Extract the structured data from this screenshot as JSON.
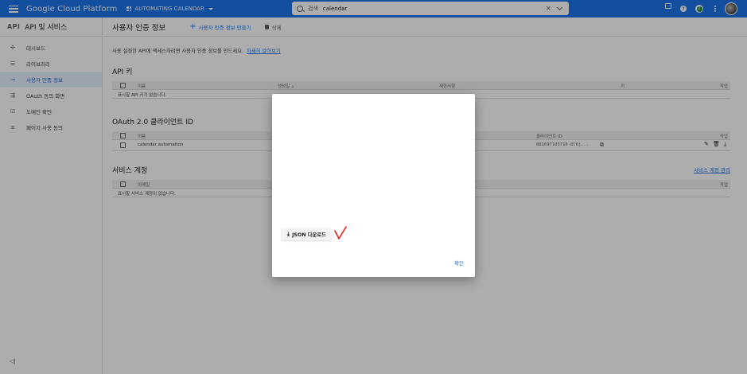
{
  "topbar": {
    "brand": "Google Cloud Platform",
    "project": "AUTOMATING CALENDAR",
    "search_placeholder": "검색",
    "search_value": "calendar",
    "clear_icon": "×",
    "badge_text": "2",
    "help_text": "?"
  },
  "sidebar": {
    "api_badge": "API",
    "title": "API 및 서비스",
    "items": [
      {
        "label": "대시보드",
        "icon": "dashboard-icon",
        "glyph": "✣"
      },
      {
        "label": "라이브러리",
        "icon": "library-icon",
        "glyph": "☰"
      },
      {
        "label": "사용자 인증 정보",
        "icon": "key-icon",
        "glyph": "⊸"
      },
      {
        "label": "OAuth 동의 화면",
        "icon": "oauth-icon",
        "glyph": "⇶"
      },
      {
        "label": "도메인 확인",
        "icon": "domain-icon",
        "glyph": "☑"
      },
      {
        "label": "페이지 사용 동의",
        "icon": "settings-icon",
        "glyph": "≡"
      }
    ],
    "active_index": 2,
    "collapse_glyph": "◁|"
  },
  "main": {
    "title": "사용자 인증 정보",
    "create_label": "사용자 인증 정보 만들기",
    "delete_label": "삭제",
    "intro_text": "사용 설정한 API에 액세스하려면 사용자 인증 정보를 만드세요.",
    "intro_link": "자세히 알아보기",
    "api_keys": {
      "title": "API 키",
      "columns": [
        "이름",
        "생성일",
        "제한사항",
        "키",
        "작업"
      ],
      "sort_arrow": "🡣",
      "empty": "표시할 API 키가 없습니다."
    },
    "oauth": {
      "title": "OAuth 2.0 클라이언트 ID",
      "columns": [
        "이름",
        "클라이언트 ID",
        "작업"
      ],
      "rows": [
        {
          "name": "calendar automation",
          "client_id": "881697103710-8l6j..."
        }
      ]
    },
    "service": {
      "title": "서비스 계정",
      "manage_link": "서비스 계정 관리",
      "columns": [
        "이메일",
        "작업"
      ],
      "empty": "표시할 서비스 계정이 없습니다."
    }
  },
  "dialog": {
    "download_label": "JSON 다운로드",
    "download_glyph": "⤓",
    "confirm_label": "확인"
  },
  "colors": {
    "primary": "#1a73e8",
    "annotation": "#e8231c"
  }
}
